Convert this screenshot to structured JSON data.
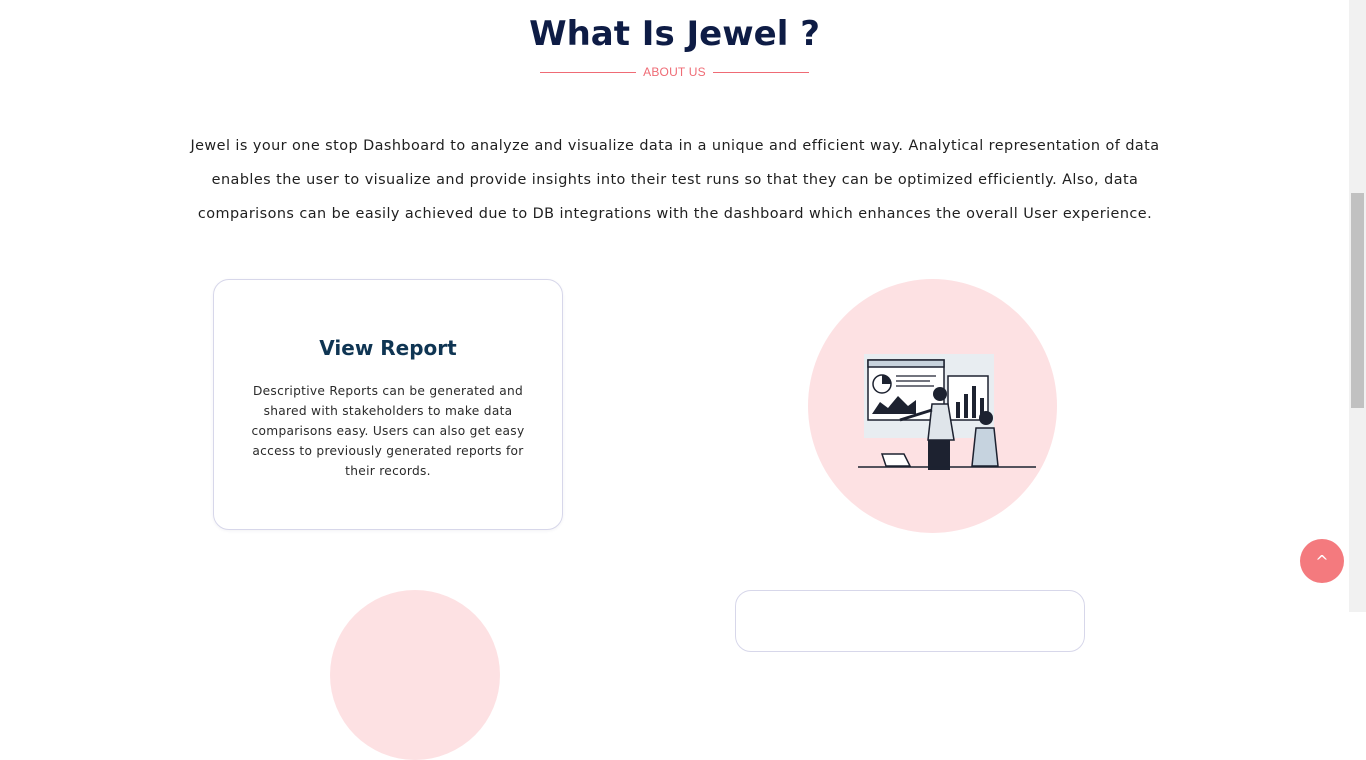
{
  "section": {
    "title": "What Is Jewel ?",
    "subtitle": "ABOUT US",
    "intro": "Jewel is your one stop Dashboard to analyze and visualize data in a unique and efficient way. Analytical representation of data enables the user to visualize and provide insights into their test runs so that they can be optimized efficiently. Also, data comparisons can be easily achieved due to DB integrations with the dashboard which enhances the overall User experience."
  },
  "feature": {
    "title": "View Report",
    "text": "Descriptive Reports can be generated and shared with stakeholders to make data comparisons easy. Users can also get easy access to previously generated reports for their records."
  },
  "scroll_top": {
    "label": "^"
  },
  "colors": {
    "heading": "#0e1c45",
    "accent": "#ef6b75",
    "card_title": "#0f3553",
    "pink_bg": "#fde1e3",
    "button": "#f47a7e"
  }
}
